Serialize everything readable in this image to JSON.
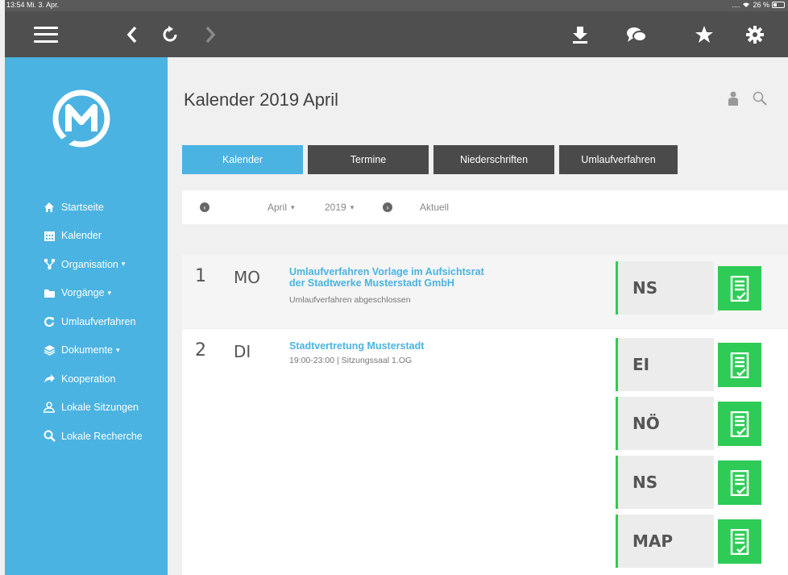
{
  "status": {
    "time": "13:54",
    "date": "Mi. 3. Apr.",
    "battery": "26 %"
  },
  "sidebar": {
    "items": [
      {
        "label": "Startseite",
        "icon": "home-icon"
      },
      {
        "label": "Kalender",
        "icon": "calendar-icon"
      },
      {
        "label": "Organisation",
        "icon": "org-chart-icon",
        "dropdown": true
      },
      {
        "label": "Vorgänge",
        "icon": "folder-icon",
        "dropdown": true
      },
      {
        "label": "Umlaufverfahren",
        "icon": "refresh-icon"
      },
      {
        "label": "Dokumente",
        "icon": "layers-icon",
        "dropdown": true
      },
      {
        "label": "Kooperation",
        "icon": "share-arrow-icon"
      },
      {
        "label": "Lokale Sitzungen",
        "icon": "people-icon"
      },
      {
        "label": "Lokale Recherche",
        "icon": "search-icon"
      }
    ],
    "caret": "▾"
  },
  "main": {
    "title": "Kalender 2019 April",
    "tabs": [
      "Kalender",
      "Termine",
      "Niederschriften",
      "Umlaufverfahren"
    ],
    "filter": {
      "month": "April",
      "year": "2019",
      "current": "Aktuell",
      "caret": "▾"
    }
  },
  "days": [
    {
      "num": "1",
      "name": "MO",
      "title_line1": "Umlaufverfahren Vorlage im Aufsichtsrat",
      "title_line2": "der Stadtwerke Musterstadt GmbH",
      "subtitle": "Umlaufverfahren abgeschlossen",
      "docs": [
        "NS"
      ]
    },
    {
      "num": "2",
      "name": "DI",
      "title_line1": "Stadtvertretung Musterstadt",
      "subtitle": "19:00-23:00 | Sitzungssaal 1.OG",
      "docs": [
        "EI",
        "NÖ",
        "NS",
        "MAP"
      ]
    }
  ],
  "colors": {
    "accent": "#4ab3e2",
    "toolbar": "#4f4f4f",
    "doc_green": "#2ecc56"
  }
}
